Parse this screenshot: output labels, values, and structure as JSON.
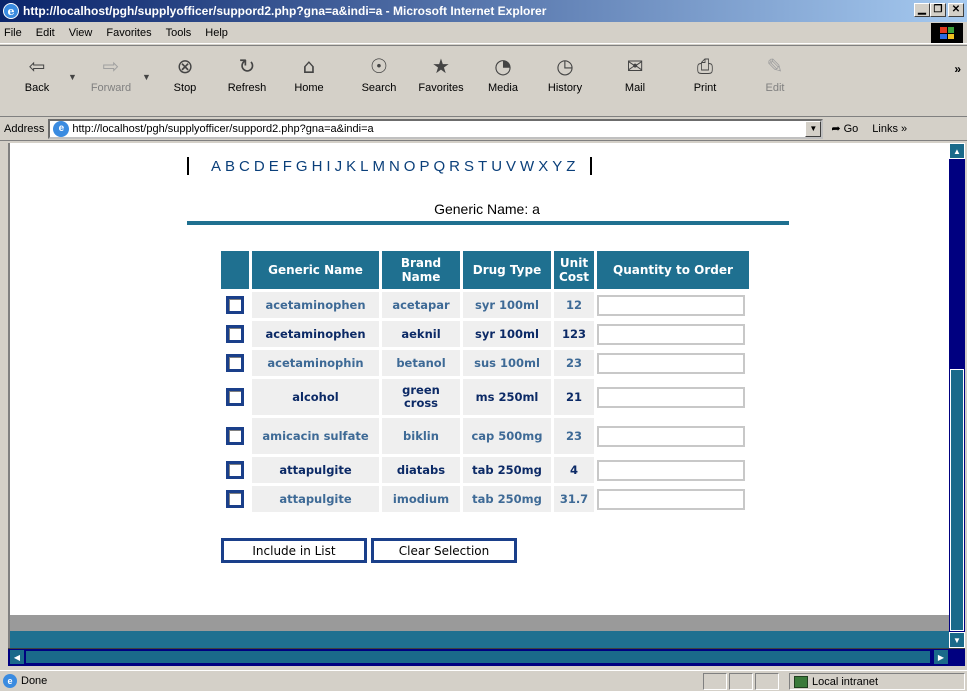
{
  "window": {
    "title": "http://localhost/pgh/supplyofficer/suppord2.php?gna=a&indi=a - Microsoft Internet Explorer",
    "buttons": [
      "_",
      "̲□",
      "×"
    ]
  },
  "menu": [
    "File",
    "Edit",
    "View",
    "Favorites",
    "Tools",
    "Help"
  ],
  "toolbar": [
    {
      "label": "Back",
      "icon": "back-arrow-icon",
      "glyph": "⇦"
    },
    {
      "label": "Forward",
      "icon": "forward-arrow-icon",
      "glyph": "⇨"
    },
    {
      "label": "Stop",
      "icon": "stop-icon",
      "glyph": "⊗"
    },
    {
      "label": "Refresh",
      "icon": "refresh-icon",
      "glyph": "↻"
    },
    {
      "label": "Home",
      "icon": "home-icon",
      "glyph": "⌂"
    },
    {
      "label": "Search",
      "icon": "search-icon",
      "glyph": "☉"
    },
    {
      "label": "Favorites",
      "icon": "favorites-icon",
      "glyph": "★"
    },
    {
      "label": "Media",
      "icon": "media-icon",
      "glyph": "◔"
    },
    {
      "label": "History",
      "icon": "history-icon",
      "glyph": "◷"
    },
    {
      "label": "Mail",
      "icon": "mail-icon",
      "glyph": "✉"
    },
    {
      "label": "Print",
      "icon": "print-icon",
      "glyph": "⎙"
    },
    {
      "label": "Edit",
      "icon": "edit-icon",
      "glyph": "✎"
    }
  ],
  "address": {
    "label": "Address",
    "url": "http://localhost/pgh/supplyofficer/suppord2.php?gna=a&indi=a",
    "go": "Go",
    "links": "Links"
  },
  "page": {
    "letters": [
      "A",
      "B",
      "C",
      "D",
      "E",
      "F",
      "G",
      "H",
      "I",
      "J",
      "K",
      "L",
      "M",
      "N",
      "O",
      "P",
      "Q",
      "R",
      "S",
      "T",
      "U",
      "V",
      "W",
      "X",
      "Y",
      "Z"
    ],
    "generic_heading": "Generic Name: a",
    "columns": [
      "Generic Name",
      "Brand Name",
      "Drug Type",
      "Unit Cost",
      "Quantity to Order"
    ],
    "rows": [
      {
        "generic": "acetaminophen",
        "brand": "acetapar",
        "type": "syr 100ml",
        "cost": "12",
        "qty": ""
      },
      {
        "generic": "acetaminophen",
        "brand": "aeknil",
        "type": "syr 100ml",
        "cost": "123",
        "qty": ""
      },
      {
        "generic": "acetaminophin",
        "brand": "betanol",
        "type": "sus 100ml",
        "cost": "23",
        "qty": ""
      },
      {
        "generic": "alcohol",
        "brand": "green cross",
        "type": "ms 250ml",
        "cost": "21",
        "qty": ""
      },
      {
        "generic": "amicacin sulfate",
        "brand": "biklin",
        "type": "cap 500mg",
        "cost": "23",
        "qty": ""
      },
      {
        "generic": "attapulgite",
        "brand": "diatabs",
        "type": "tab 250mg",
        "cost": "4",
        "qty": ""
      },
      {
        "generic": "attapulgite",
        "brand": "imodium",
        "type": "tab 250mg",
        "cost": "31.7",
        "qty": ""
      }
    ],
    "include_button": "Include in List",
    "clear_button": "Clear Selection"
  },
  "status": {
    "text": "Done",
    "zone": "Local intranet"
  },
  "colors": {
    "accent": "#1f7090",
    "link": "#0a3f7a",
    "checkbox_border": "#1a3f8a"
  }
}
